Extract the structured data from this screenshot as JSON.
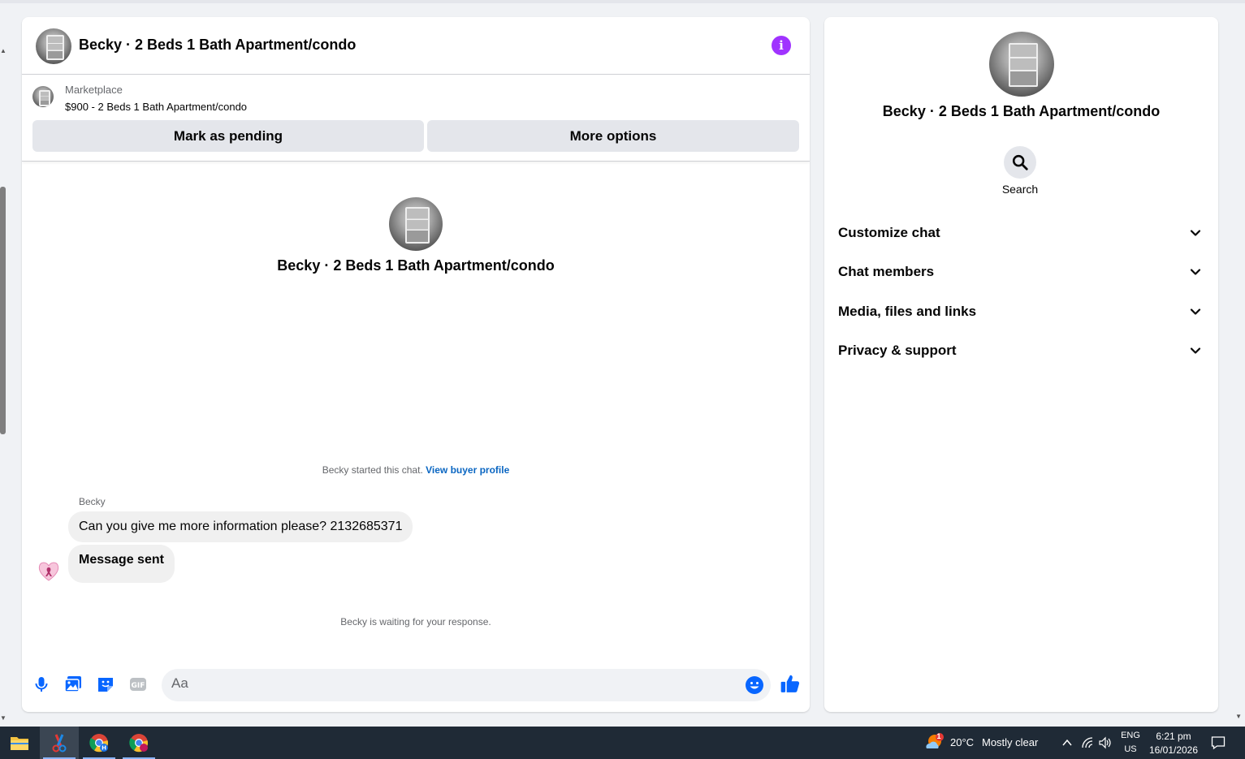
{
  "conversation": {
    "title": "Becky · 2 Beds 1 Bath Apartment/condo"
  },
  "marketplace": {
    "label": "Marketplace",
    "listing": "$900 - 2 Beds 1 Bath Apartment/condo",
    "mark_pending_label": "Mark as pending",
    "more_options_label": "More options"
  },
  "thread": {
    "intro_name": "Becky · 2 Beds 1 Bath Apartment/condo",
    "started_text": "Becky started this chat.",
    "view_profile_link": "View buyer profile",
    "sender_name": "Becky",
    "messages": [
      "Can you give me more information please? 2132685371",
      "Message sent"
    ],
    "waiting_text": "Becky is waiting for your response."
  },
  "composer": {
    "placeholder": "Aa"
  },
  "details": {
    "name": "Becky · 2 Beds 1 Bath Apartment/condo",
    "search_label": "Search",
    "sections": [
      "Customize chat",
      "Chat members",
      "Media, files and links",
      "Privacy & support"
    ]
  },
  "taskbar": {
    "weather_temp": "20°C",
    "weather_desc": "Mostly clear",
    "weather_badge": "1",
    "lang_top": "ENG",
    "lang_bottom": "US",
    "time": "6:21 pm",
    "date": "16/01/2026"
  },
  "colors": {
    "accent": "#0866ff",
    "info": "#a033ff",
    "link": "#0a66c2",
    "taskbar": "#1f2a36"
  }
}
